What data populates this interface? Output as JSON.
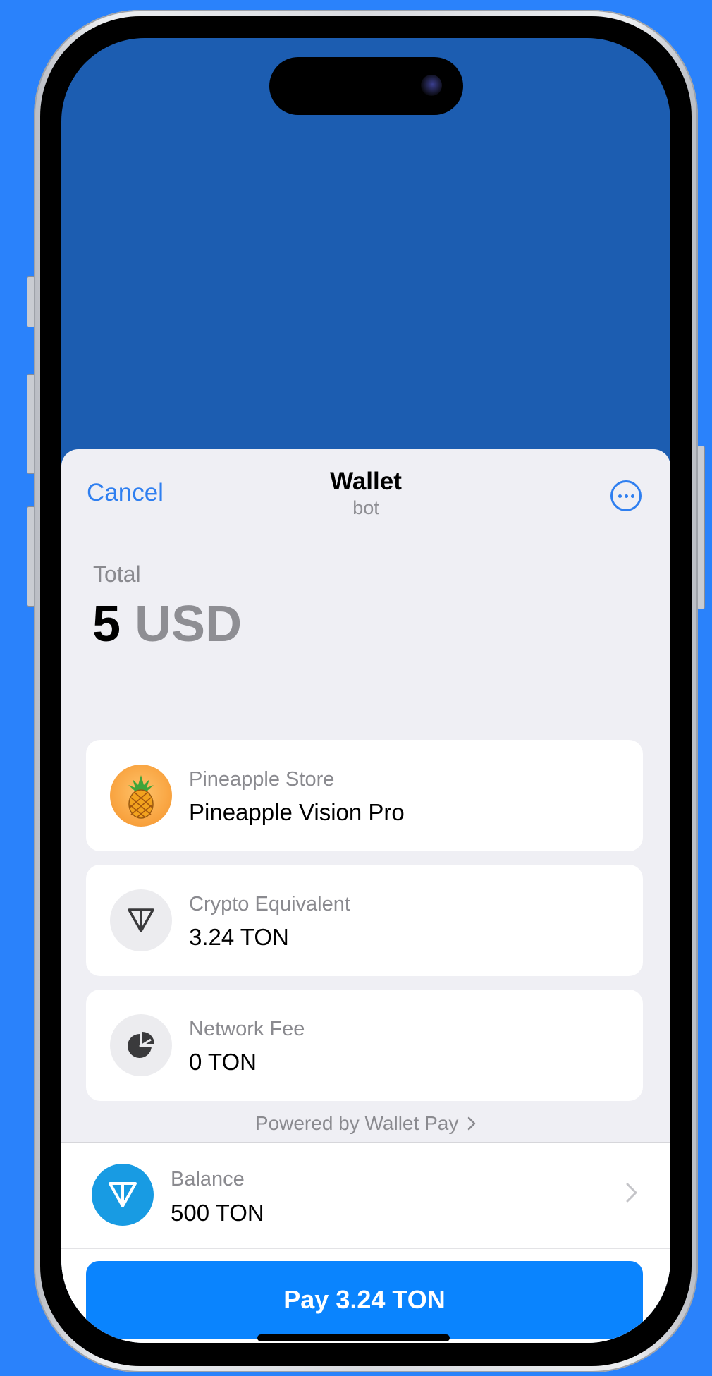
{
  "sheet": {
    "cancel_label": "Cancel",
    "title": "Wallet",
    "subtitle": "bot",
    "more_icon": "ellipsis-circle-icon"
  },
  "total": {
    "label": "Total",
    "amount": "5",
    "currency": "USD"
  },
  "items": [
    {
      "label": "Pineapple Store",
      "value": "Pineapple Vision Pro",
      "icon": "pineapple-icon"
    },
    {
      "label": "Crypto Equivalent",
      "value": "3.24 TON",
      "icon": "ton-icon"
    },
    {
      "label": "Network Fee",
      "value": "0 TON",
      "icon": "pie-chart-icon"
    }
  ],
  "powered_by": "Powered by Wallet Pay",
  "balance": {
    "label": "Balance",
    "value": "500 TON",
    "icon": "ton-icon"
  },
  "pay_button_label": "Pay 3.24 TON",
  "colors": {
    "background": "#2a82fb",
    "accent": "#0a84fe",
    "ton_blue": "#189be3",
    "sheet_bg": "#efeff4"
  }
}
